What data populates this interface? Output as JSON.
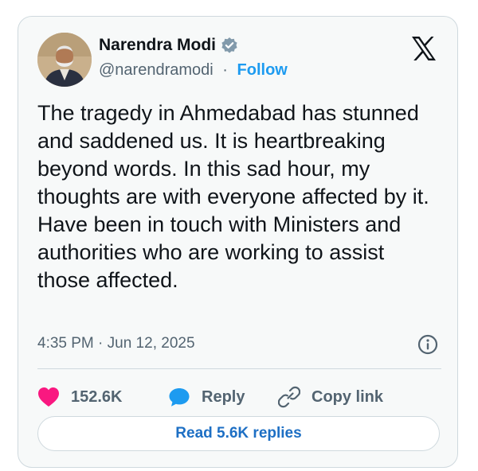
{
  "author": {
    "name": "Narendra Modi",
    "handle": "@narendramodi",
    "separator": "·",
    "follow_label": "Follow",
    "verified": true
  },
  "tweet": {
    "text": "The tragedy in Ahmedabad has stunned and saddened us. It is heartbreaking beyond words. In this sad hour, my thoughts are with everyone affected by it. Have been in touch with Ministers and authorities who are working to assist those affected.",
    "timestamp": "4:35 PM · Jun 12, 2025"
  },
  "actions": {
    "likes": "152.6K",
    "reply_label": "Reply",
    "copy_label": "Copy link"
  },
  "footer": {
    "read_replies_label": "Read 5.6K replies"
  },
  "colors": {
    "accent": "#1d9bf0",
    "like": "#f91880",
    "verified": "#829aab",
    "text": "#0f1419",
    "muted": "#536471"
  },
  "icons": [
    "verified-badge-icon",
    "x-logo-icon",
    "info-icon",
    "heart-icon",
    "reply-bubble-icon",
    "link-icon"
  ]
}
